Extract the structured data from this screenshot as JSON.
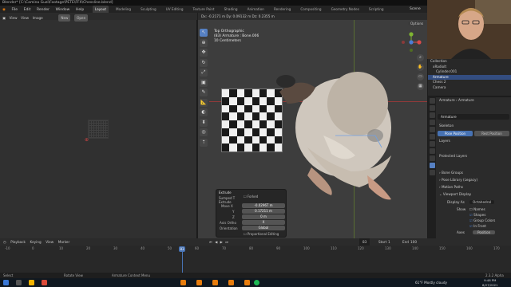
{
  "window": {
    "title": "Blender* [C:\\Camina Guzi\\Footage\\PETE\\FFX\\Chessline.blend]",
    "controls": "— ▢ ✕"
  },
  "menu": [
    "File",
    "Edit",
    "Render",
    "Window",
    "Help"
  ],
  "workspaces": [
    "Layout",
    "Modeling",
    "Sculpting",
    "UV Editing",
    "Texture Paint",
    "Shading",
    "Animation",
    "Rendering",
    "Compositing",
    "Geometry Nodes",
    "Scripting"
  ],
  "active_workspace": "Layout",
  "scene_label": "Scene",
  "image_editor": {
    "menu": [
      "View",
      "View",
      "Image"
    ],
    "new_label": "New",
    "open_label": "Open"
  },
  "viewport": {
    "header_readout": "Dx: -0.2171 m  Dy: 0.09132 m  Dz: 0.2355 m",
    "info": [
      "Top Orthographic",
      "(83) Armature : Bone.006",
      "10 Centimeters"
    ],
    "options_label": "Options"
  },
  "op_panel": {
    "title": "Extrude",
    "mode_icon_label": "Sumped T",
    "flipped_label": "Extrude",
    "label_forked": "Forked",
    "move_label": "Move X",
    "y_label": "Y",
    "z_label": "Z",
    "move_x": "-0.0296T m",
    "move_y": "0.17211 m",
    "move_z": "0 m",
    "axis_ortho_label": "Axis Ortho",
    "axis_ortho_value": "X",
    "orientation_label": "Orientation",
    "orientation_value": "Global",
    "proportional_label": "Proportional Editing"
  },
  "outliner": {
    "rows": [
      "Collection",
      "xRadioIt",
      "Cylinder.001",
      "Armature",
      "Chess 2",
      "Camera"
    ]
  },
  "properties": {
    "breadcrumb": [
      "Armature",
      "Armature"
    ],
    "name_field": "Armature",
    "skeleton_label": "Skeleton",
    "pose_position": "Pose Position",
    "rest_position": "Rest Position",
    "layers_label": "Layers",
    "protected_layers_label": "Protected Layers",
    "sections": [
      "Bone Groups",
      "Pose Library (Legacy)",
      "Motion Paths",
      "Viewport Display"
    ],
    "display_as_label": "Display As",
    "display_as_value": "Octahedral",
    "show_label": "Show",
    "checks": [
      "Names",
      "Shapes",
      "Group Colors",
      "In Front"
    ],
    "axes_label": "Axes",
    "position_label": "Position",
    "ik_section": "Inverse Kinematics",
    "mirror_label": "Wiggle Armature",
    "custom_props": "Custom Properties"
  },
  "timeline": {
    "menu": [
      "Playback",
      "Keying",
      "View",
      "Marker"
    ],
    "current_frame": "83",
    "start_label": "Start",
    "start": "1",
    "end_label": "End",
    "end": "100",
    "ticks": [
      "-10",
      "0",
      "10",
      "20",
      "30",
      "40",
      "50",
      "60",
      "70",
      "80",
      "90",
      "100",
      "110",
      "120",
      "130",
      "140",
      "150",
      "160",
      "170"
    ]
  },
  "statusbar": {
    "left": "Select",
    "mid1": "Rotate View",
    "mid2": "Armature Context Menu",
    "version": "2.3.2 Alpha"
  },
  "taskbar": {
    "weather": "61°F  Mostly cloudy",
    "time": "9:46 PM",
    "date": "8/27/2021"
  }
}
